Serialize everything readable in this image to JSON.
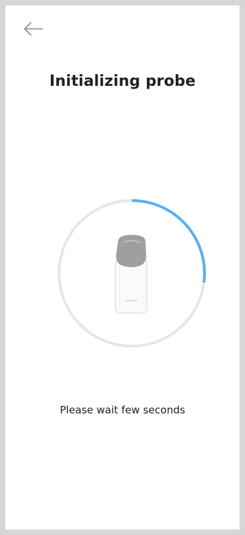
{
  "header": {
    "back_icon": "arrow-left-icon",
    "title": "Initializing probe"
  },
  "progress": {
    "value": 0.27,
    "track_color": "#e6e6e6",
    "fill_color": "#5aaef0",
    "probe_icon": "ultrasound-probe-icon"
  },
  "status": {
    "message": "Please wait few seconds"
  }
}
